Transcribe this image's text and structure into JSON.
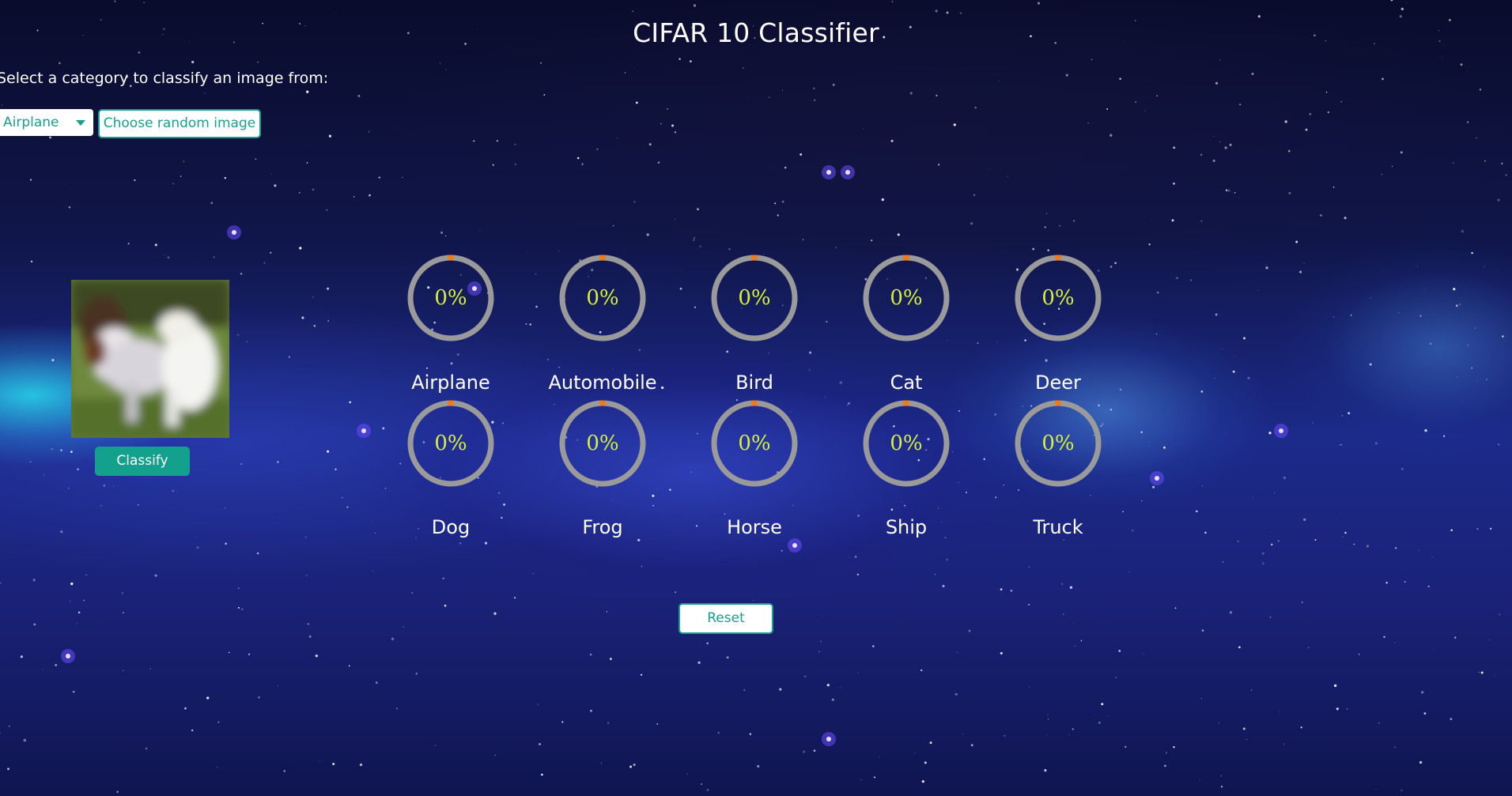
{
  "page_title": "CIFAR 10 Classifier",
  "prompt_text": "Select a category to classify an image from:",
  "category_select": {
    "selected": "Airplane"
  },
  "random_button_label": "Choose random image",
  "classify_button_label": "Classify",
  "reset_button_label": "Reset",
  "colors": {
    "accent": "#13a08d",
    "gauge_track": "#9a9a9a",
    "gauge_progress": "#f07b10",
    "gauge_text": "#d6f03a"
  },
  "predictions": [
    {
      "label": "Airplane",
      "percent_text": "0%",
      "value": 0
    },
    {
      "label": "Automobile",
      "percent_text": "0%",
      "value": 0
    },
    {
      "label": "Bird",
      "percent_text": "0%",
      "value": 0
    },
    {
      "label": "Cat",
      "percent_text": "0%",
      "value": 0
    },
    {
      "label": "Deer",
      "percent_text": "0%",
      "value": 0
    },
    {
      "label": "Dog",
      "percent_text": "0%",
      "value": 0
    },
    {
      "label": "Frog",
      "percent_text": "0%",
      "value": 0
    },
    {
      "label": "Horse",
      "percent_text": "0%",
      "value": 0
    },
    {
      "label": "Ship",
      "percent_text": "0%",
      "value": 0
    },
    {
      "label": "Truck",
      "percent_text": "0%",
      "value": 0
    }
  ]
}
